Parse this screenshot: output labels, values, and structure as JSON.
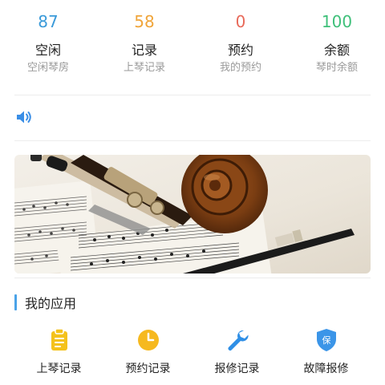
{
  "stats": [
    {
      "value": "87",
      "title": "空闲",
      "subtitle": "空闲琴房",
      "color": "#3a9ad9"
    },
    {
      "value": "58",
      "title": "记录",
      "subtitle": "上琴记录",
      "color": "#f0a53a"
    },
    {
      "value": "0",
      "title": "预约",
      "subtitle": "我的预约",
      "color": "#e86a5a"
    },
    {
      "value": "100",
      "title": "余额",
      "subtitle": "琴时余额",
      "color": "#3fc07a"
    }
  ],
  "notice": {
    "icon": "speaker-icon",
    "color": "#3a8ee6"
  },
  "section": {
    "title": "我的应用",
    "accent": "#4aa3e8"
  },
  "apps": [
    {
      "label": "上琴记录",
      "icon": "clipboard-icon"
    },
    {
      "label": "预约记录",
      "icon": "clock-icon"
    },
    {
      "label": "报修记录",
      "icon": "wrench-icon"
    },
    {
      "label": "故障报修",
      "icon": "shield-icon",
      "badge": "保"
    }
  ]
}
